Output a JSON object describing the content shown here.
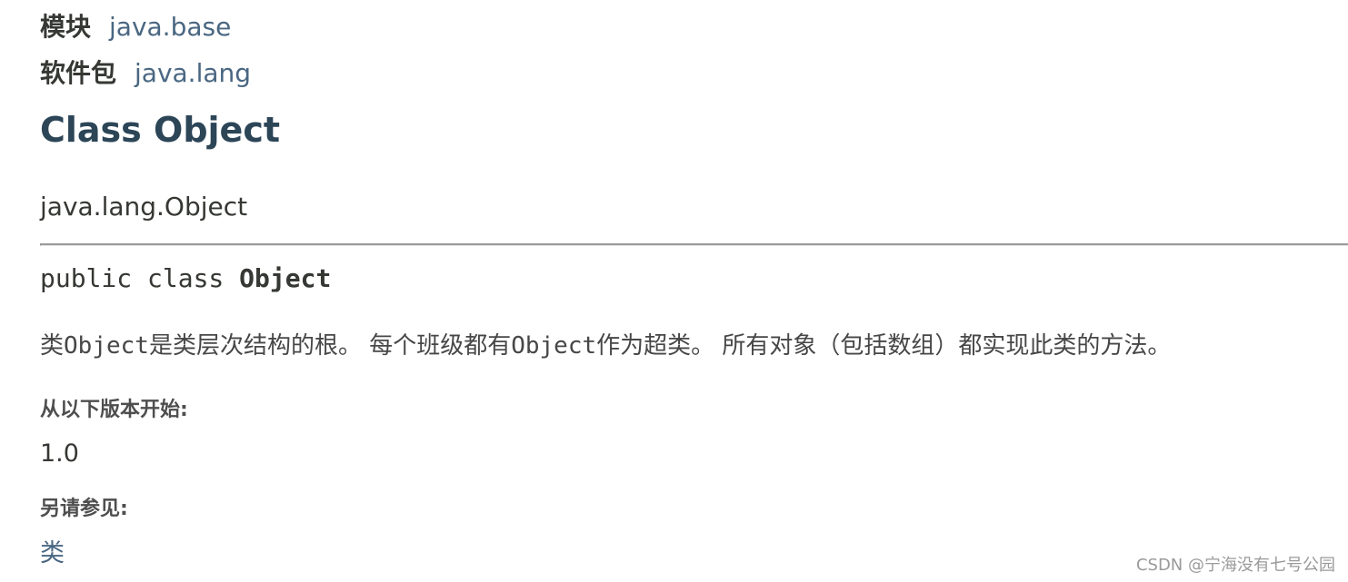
{
  "header": {
    "module_label": "模块",
    "module_value": "java.base",
    "package_label": "软件包",
    "package_value": "java.lang",
    "title": "Class Object"
  },
  "inheritance": "java.lang.Object",
  "signature": {
    "modifiers": "public class ",
    "type_name": "Object"
  },
  "description": {
    "part1": "类",
    "code1": "Object",
    "part2": "是类层次结构的根。 每个班级都有",
    "code2": "Object",
    "part3": "作为超类。 所有对象（包括数组）都实现此类的方法。"
  },
  "since": {
    "label": "从以下版本开始:",
    "value": "1.0"
  },
  "see_also": {
    "label": "另请参见:",
    "value": "类"
  },
  "watermark": "CSDN @宁海没有七号公园"
}
